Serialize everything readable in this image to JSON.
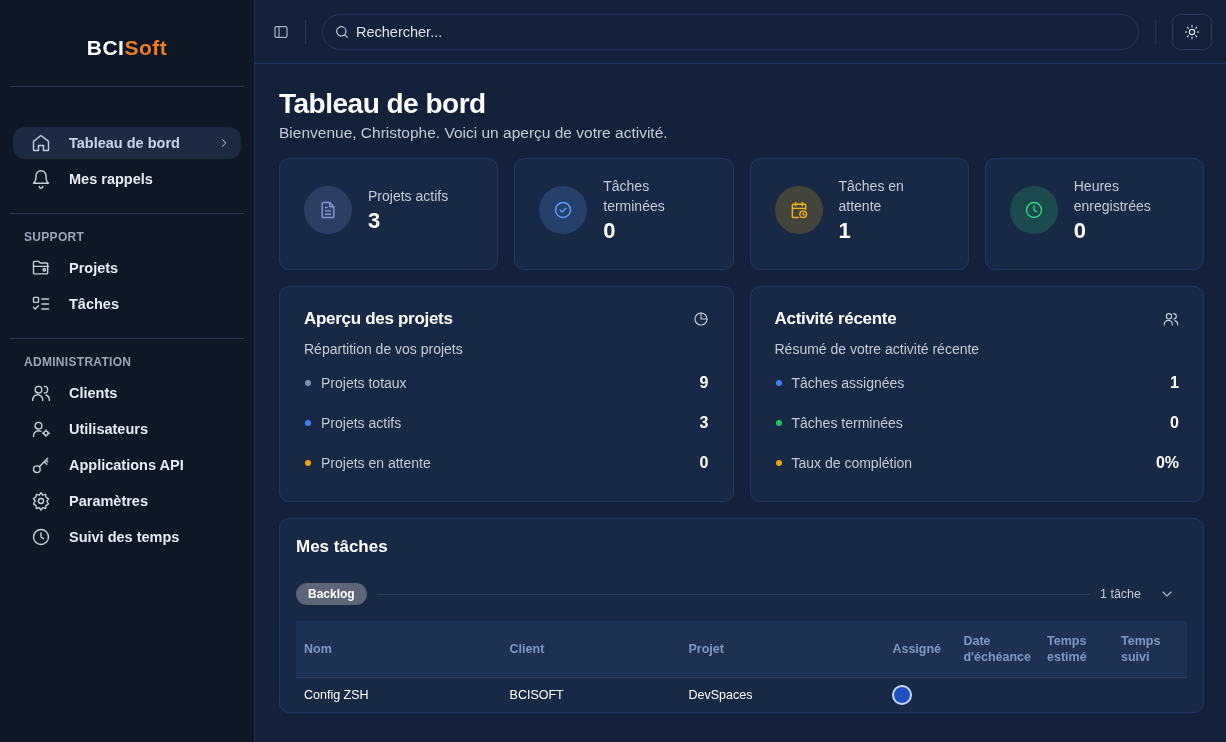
{
  "sidebar": {
    "logo": {
      "primary": "BCI",
      "accent": "Soft"
    },
    "sections": [
      {
        "items": [
          {
            "label": "Tableau de bord",
            "kind": "home",
            "selected": true
          },
          {
            "label": "Mes rappels",
            "kind": "bell",
            "selected": false
          }
        ]
      },
      {
        "heading": "SUPPORT",
        "items": [
          {
            "label": "Projets",
            "kind": "folder",
            "selected": false
          },
          {
            "label": "Tâches",
            "kind": "list",
            "selected": false
          }
        ]
      },
      {
        "heading": "ADMINISTRATION",
        "items": [
          {
            "label": "Clients",
            "kind": "users",
            "selected": false
          },
          {
            "label": "Utilisateurs",
            "kind": "usergear",
            "selected": false
          },
          {
            "label": "Applications API",
            "kind": "key",
            "selected": false
          },
          {
            "label": "Paramètres",
            "kind": "gear",
            "selected": false
          },
          {
            "label": "Suivi des temps",
            "kind": "clock",
            "selected": false
          }
        ]
      }
    ]
  },
  "topbar": {
    "search": {
      "placeholder": "Rechercher..."
    }
  },
  "page": {
    "title": "Tableau de bord",
    "subtitle": "Bienvenue, Christophe. Voici un aperçu de votre activité."
  },
  "stats": [
    {
      "label": "Projets actifs",
      "value": "3",
      "kind": "document",
      "color": "#8b93d6"
    },
    {
      "label": "Tâches terminées",
      "value": "0",
      "kind": "check",
      "color": "#5ea2ff"
    },
    {
      "label": "Tâches en attente",
      "value": "1",
      "kind": "calendar",
      "color": "#f5b316"
    },
    {
      "label": "Heures enregistrées",
      "value": "0",
      "kind": "clock",
      "color": "#34d77a"
    }
  ],
  "panels": [
    {
      "title": "Aperçu des projets",
      "kind": "pie",
      "subtitle": "Répartition de vos projets",
      "rows": [
        {
          "label": "Projets totaux",
          "value": "9",
          "color": "#7d93bd"
        },
        {
          "label": "Projets actifs",
          "value": "3",
          "color": "#3b82f6"
        },
        {
          "label": "Projets en attente",
          "value": "0",
          "color": "#f59e0b"
        }
      ]
    },
    {
      "title": "Activité récente",
      "kind": "users",
      "subtitle": "Résumé de votre activité récente",
      "rows": [
        {
          "label": "Tâches assignées",
          "value": "1",
          "color": "#3b82f6"
        },
        {
          "label": "Tâches terminées",
          "value": "0",
          "color": "#22c55e"
        },
        {
          "label": "Taux de complétion",
          "value": "0%",
          "color": "#f59e0b"
        }
      ]
    }
  ],
  "tasks": {
    "title": "Mes tâches",
    "group": {
      "name": "Backlog",
      "count": "1 tâche",
      "expanded": true
    },
    "columns": [
      "Nom",
      "Client",
      "Projet",
      "Assigné",
      "Date d'échéance",
      "Temps estimé",
      "Temps suivi"
    ],
    "rows": [
      {
        "name": "Config ZSH",
        "client": "BCISOFT",
        "project": "DevSpaces"
      }
    ]
  }
}
